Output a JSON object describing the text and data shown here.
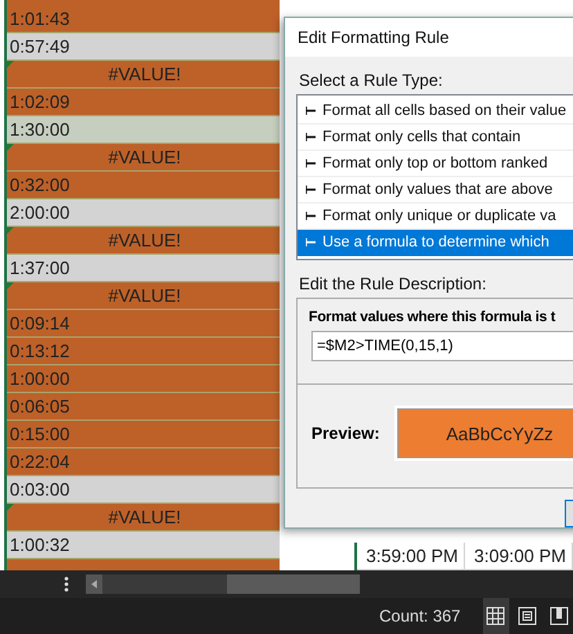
{
  "sheet": {
    "rows": [
      {
        "kind": "time",
        "text": "1:01:43",
        "color": "#bd6129"
      },
      {
        "kind": "time",
        "text": "0:57:49",
        "color": "#d3d3d3"
      },
      {
        "kind": "error",
        "text": "#VALUE!",
        "color": "#bd6129"
      },
      {
        "kind": "time",
        "text": "1:02:09",
        "color": "#bd6129"
      },
      {
        "kind": "time",
        "text": "1:30:00",
        "color": "#c6cfbf"
      },
      {
        "kind": "error",
        "text": "#VALUE!",
        "color": "#bd6129"
      },
      {
        "kind": "time",
        "text": "0:32:00",
        "color": "#bd6129"
      },
      {
        "kind": "time",
        "text": "2:00:00",
        "color": "#d3d3d3"
      },
      {
        "kind": "error",
        "text": "#VALUE!",
        "color": "#bd6129"
      },
      {
        "kind": "time",
        "text": "1:37:00",
        "color": "#d3d3d3"
      },
      {
        "kind": "error",
        "text": "#VALUE!",
        "color": "#bd6129"
      },
      {
        "kind": "time",
        "text": "0:09:14",
        "color": "#bd6129"
      },
      {
        "kind": "time",
        "text": "0:13:12",
        "color": "#bd6129"
      },
      {
        "kind": "time",
        "text": "1:00:00",
        "color": "#bd6129"
      },
      {
        "kind": "time",
        "text": "0:06:05",
        "color": "#bd6129"
      },
      {
        "kind": "time",
        "text": "0:15:00",
        "color": "#bd6129"
      },
      {
        "kind": "time",
        "text": "0:22:04",
        "color": "#bd6129"
      },
      {
        "kind": "time",
        "text": "0:03:00",
        "color": "#d3d3d3"
      },
      {
        "kind": "error",
        "text": "#VALUE!",
        "color": "#bd6129"
      },
      {
        "kind": "time",
        "text": "1:00:32",
        "color": "#d3d3d3"
      }
    ],
    "right_row": [
      "3:59:00 PM",
      "3:09:00 PM"
    ]
  },
  "dialog": {
    "title": "Edit Formatting Rule",
    "rule_type_label": "Select a Rule Type:",
    "rule_types": [
      {
        "label": "Format all cells based on their value",
        "selected": false
      },
      {
        "label": "Format only cells that contain",
        "selected": false
      },
      {
        "label": "Format only top or bottom ranked",
        "selected": false
      },
      {
        "label": "Format only values that are above",
        "selected": false
      },
      {
        "label": "Format only unique or duplicate va",
        "selected": false
      },
      {
        "label": "Use a formula to determine which",
        "selected": true
      }
    ],
    "description_label": "Edit the Rule Description:",
    "formula_label": "Format values where this formula is t",
    "formula": "=$M2>TIME(0,15,1)",
    "preview_label": "Preview:",
    "preview_text": "AaBbCcYyZz"
  },
  "status_bar": {
    "count": "Count: 367",
    "views": [
      {
        "kind": "normal",
        "selected": true
      },
      {
        "kind": "layout",
        "selected": false
      },
      {
        "kind": "break",
        "selected": false
      }
    ]
  }
}
